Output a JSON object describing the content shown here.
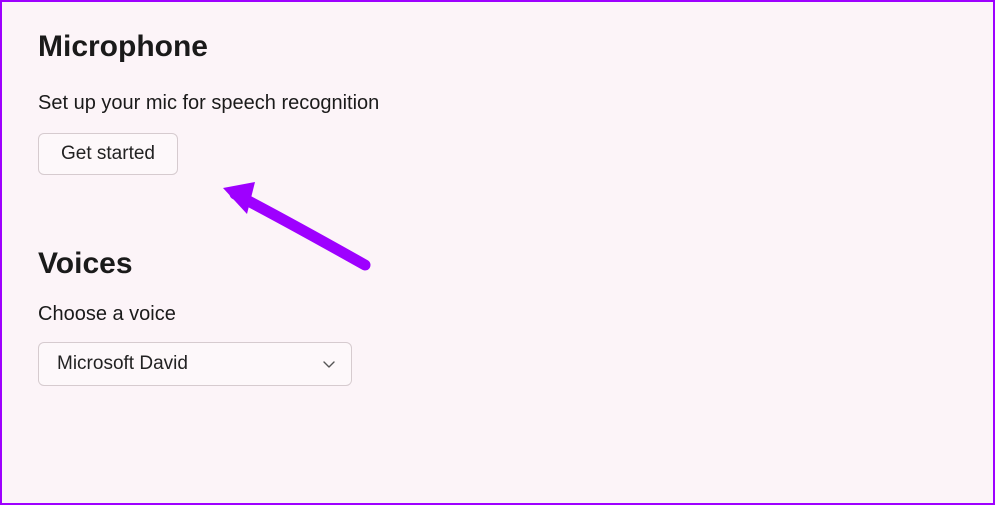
{
  "microphone": {
    "heading": "Microphone",
    "description": "Set up your mic for speech recognition",
    "button_label": "Get started"
  },
  "voices": {
    "heading": "Voices",
    "label": "Choose a voice",
    "selected": "Microsoft David"
  },
  "annotation": {
    "color": "#9e00ff"
  }
}
